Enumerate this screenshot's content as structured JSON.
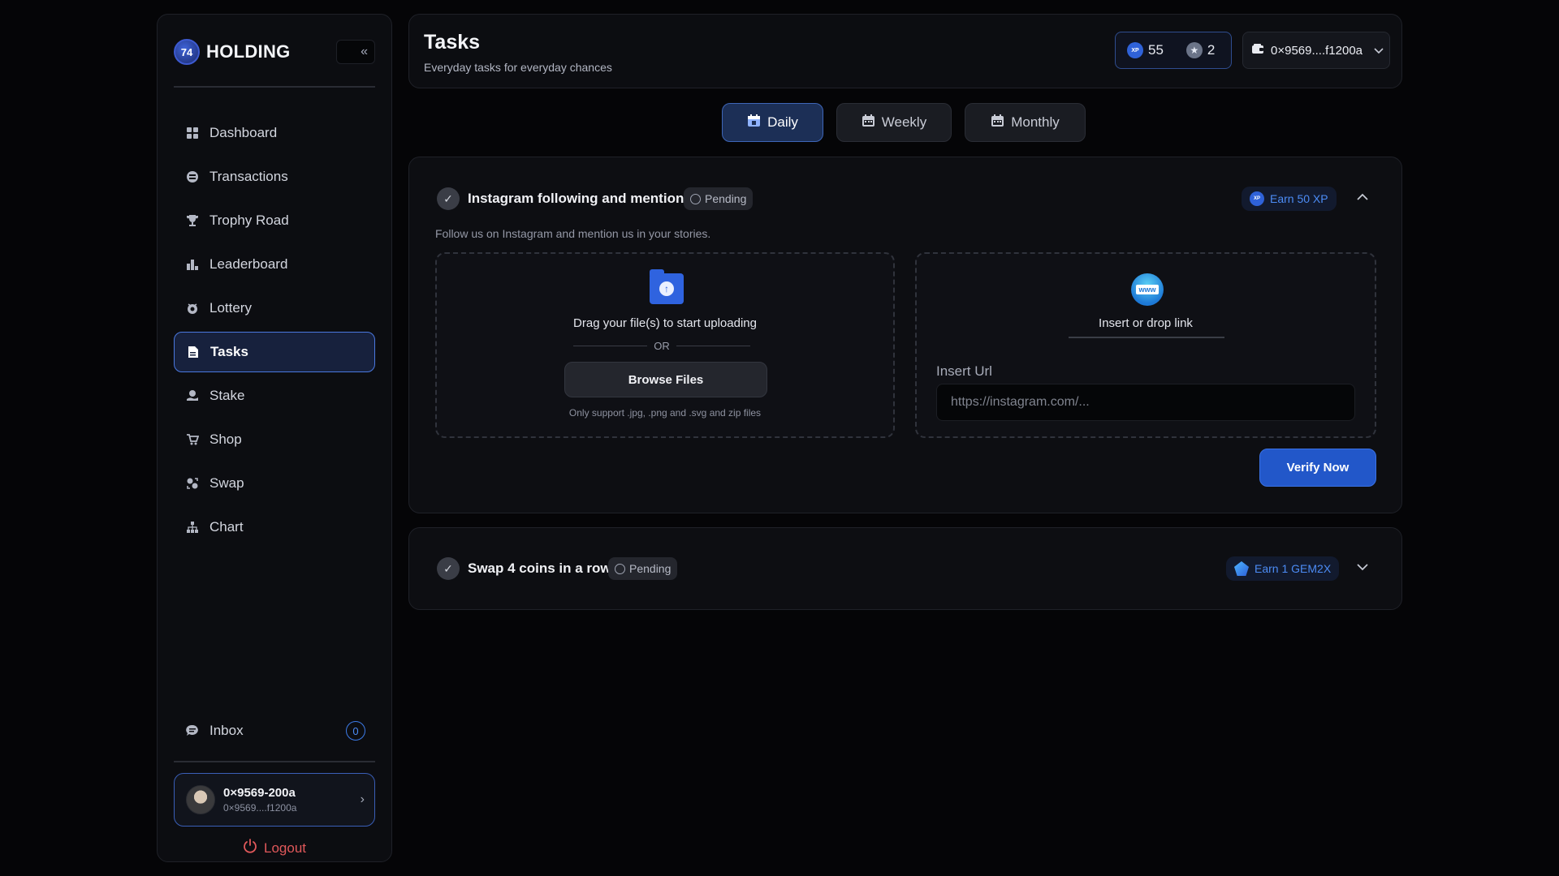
{
  "brand": {
    "name": "HOLDING",
    "logo_text": "74"
  },
  "sidebar": {
    "collapse_icon": "«",
    "items": [
      {
        "label": "Dashboard",
        "icon": "grid-icon"
      },
      {
        "label": "Transactions",
        "icon": "coin-icon"
      },
      {
        "label": "Trophy Road",
        "icon": "trophy-icon"
      },
      {
        "label": "Leaderboard",
        "icon": "podium-icon"
      },
      {
        "label": "Lottery",
        "icon": "lottery-icon"
      },
      {
        "label": "Tasks",
        "icon": "document-icon",
        "active": true
      },
      {
        "label": "Stake",
        "icon": "stake-icon"
      },
      {
        "label": "Shop",
        "icon": "cart-icon"
      },
      {
        "label": "Swap",
        "icon": "swap-icon"
      },
      {
        "label": "Chart",
        "icon": "chart-icon"
      }
    ],
    "inbox": {
      "label": "Inbox",
      "count": "0"
    },
    "user": {
      "name": "0×9569-200a",
      "address": "0×9569....f1200a"
    },
    "logout_label": "Logout"
  },
  "header": {
    "title": "Tasks",
    "subtitle": "Everyday tasks for everyday chances",
    "xp_value": "55",
    "xp_badge": "XP",
    "gem_value": "2",
    "wallet": "0×9569....f1200a"
  },
  "tabs": [
    {
      "label": "Daily",
      "active": true
    },
    {
      "label": "Weekly",
      "active": false
    },
    {
      "label": "Monthly",
      "active": false
    }
  ],
  "tasks": [
    {
      "title": "Instagram following and mentions",
      "status": "Pending",
      "reward": "Earn 50 XP",
      "description": "Follow us on Instagram and mention us in your stories.",
      "upload": {
        "drag_text": "Drag your file(s) to start uploading",
        "or_text": "OR",
        "browse_label": "Browse Files",
        "support_text": "Only support .jpg, .png and .svg and zip files"
      },
      "link": {
        "label": "Insert or drop link",
        "globe_text": "www",
        "url_label": "Insert Url",
        "url_placeholder": "https://instagram.com/..."
      },
      "verify_label": "Verify Now",
      "expanded": true
    },
    {
      "title": "Swap 4 coins in a row",
      "status": "Pending",
      "reward": "Earn 1 GEM2X",
      "expanded": false
    }
  ],
  "colors": {
    "accent": "#2f62d8",
    "background": "#050507",
    "panel": "#0c0d11",
    "danger": "#e0585a"
  }
}
